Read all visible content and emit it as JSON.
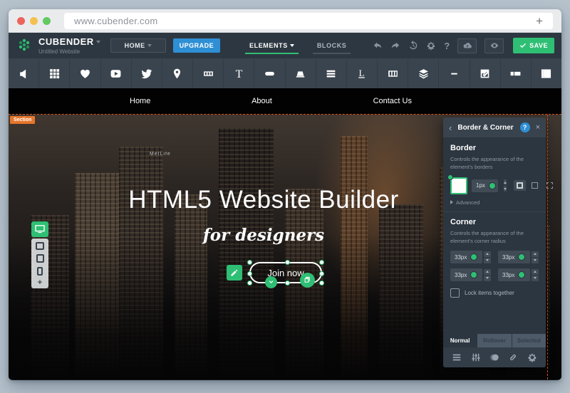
{
  "browser": {
    "url": "www.cubender.com",
    "new_tab_label": "+"
  },
  "header": {
    "brand": "CUBENDER",
    "subtitle": "Untitled Website",
    "home_button": "HOME",
    "upgrade_button": "UPGRADE",
    "tabs": {
      "elements": "ELEMENTS",
      "blocks": "BLOCKS"
    },
    "help_glyph": "?",
    "save_button": "SAVE",
    "accent_green": "#2fbf74",
    "upgrade_blue": "#2e8fd4"
  },
  "toolbar": {
    "icons": [
      "speaker",
      "grid",
      "heart",
      "video-play",
      "twitter",
      "map-pin",
      "filmstrip",
      "text",
      "button-pill",
      "podium",
      "menu-lines",
      "label",
      "columns",
      "layers",
      "divider",
      "checkbox",
      "input-field",
      "panel-block"
    ]
  },
  "site": {
    "nav": {
      "home": "Home",
      "about": "About",
      "contact": "Contact Us"
    },
    "section_label": "Section",
    "building_sign": "MetLife",
    "hero_title": "HTML5 Website Builder",
    "hero_subtitle": "for designers",
    "cta_label": "Join now",
    "section_outline_color": "#d9521d"
  },
  "panel": {
    "back_glyph": "‹",
    "title": "Border & Corner",
    "help_glyph": "?",
    "close_glyph": "×",
    "border": {
      "heading": "Border",
      "description": "Controls the appearance of the element's borders",
      "width_value": "1px",
      "advanced_label": "Advanced"
    },
    "corner": {
      "heading": "Corner",
      "description": "Controls the appearance of the element's corner radius",
      "values": [
        "33px",
        "33px",
        "33px",
        "33px"
      ],
      "lock_label": "Lock items together"
    },
    "state_tabs": {
      "normal": "Normal",
      "rollover": "Rollover",
      "selected": "Selected"
    }
  }
}
